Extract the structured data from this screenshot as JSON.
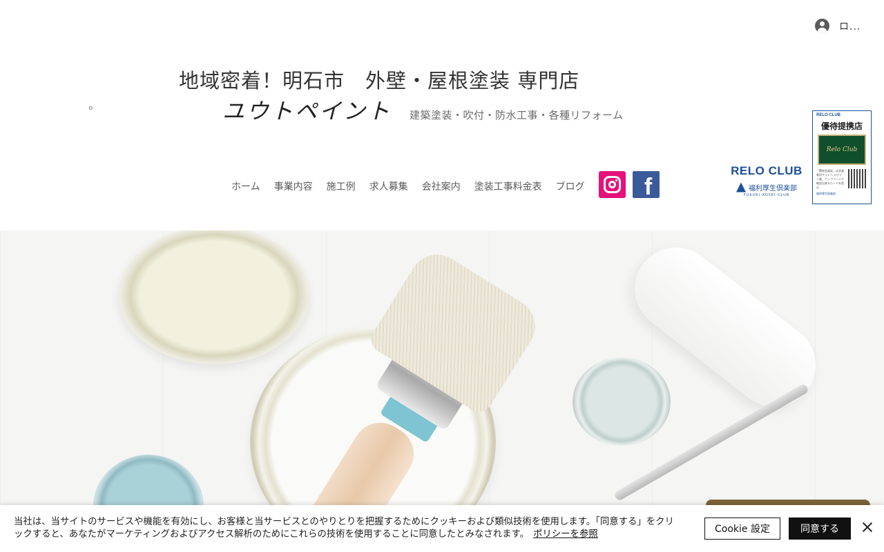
{
  "header": {
    "login_label": "ロ...",
    "title_main": "地域密着！明石市　外壁・屋根塗装 専門店",
    "title_brand": "ユウトペイント",
    "subtitle": "建築塗装・吹付・防水工事・各種リフォーム"
  },
  "nav": {
    "items": [
      {
        "label": "ホーム"
      },
      {
        "label": "事業内容"
      },
      {
        "label": "施工例"
      },
      {
        "label": "求人募集"
      },
      {
        "label": "会社案内"
      },
      {
        "label": "塗装工事料金表"
      },
      {
        "label": "ブログ"
      }
    ]
  },
  "social": {
    "instagram": "instagram-icon",
    "facebook": "facebook-icon",
    "instagram_color": "#e4127a",
    "facebook_color": "#3b5a9a"
  },
  "relo": {
    "logo_word": "RELO CLUB",
    "logo_sub": "福利厚生倶楽部",
    "logo_roman": "FUKURI KOSEI CLUB",
    "card_header": "RELO CLUB",
    "card_badge": "優待提携店",
    "card_inner": "Relo Club",
    "card_text": "「関係会員証」は会員専用サイトへ ログイン後、アップページで確認出来るカードを提示",
    "card_brand": "福利厚生倶楽部",
    "brand_color": "#1c4f9c"
  },
  "cookie": {
    "message": "当社は、当サイトのサービスや機能を有効にし、お客様と当サービスとのやりとりを把握するためにクッキーおよび類似技術を使用します。「同意する」をクリックすると、あなたがマーケティングおよびアクセス解析のためにこれらの技術を使用することに同意したとみなされます。",
    "policy_link": "ポリシーを参照",
    "settings_label": "Cookie 設定",
    "agree_label": "同意する"
  }
}
